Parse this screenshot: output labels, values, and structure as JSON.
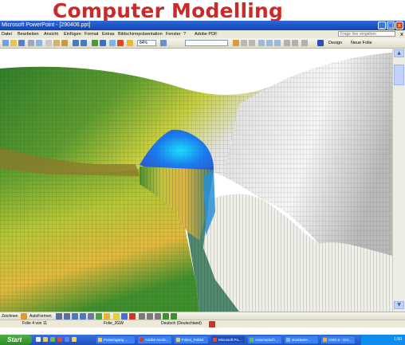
{
  "banner": {
    "title": "Computer Modelling"
  },
  "window": {
    "title": "Microsoft PowerPoint - [290406.ppt]",
    "controls": [
      "_",
      "□",
      "x"
    ]
  },
  "menubar": {
    "items": [
      "Datei",
      "Bearbeiten",
      "Ansicht",
      "Einfügen",
      "Format",
      "Extras",
      "Bildschirmpräsentation",
      "Fenster",
      "?",
      "Adobe PDF"
    ],
    "help_placeholder": "Frage hier eingeben",
    "doc_close": "x"
  },
  "toolbar": {
    "zoom": "84%",
    "design_label": "Design",
    "new_slide_label": "Neue Folie"
  },
  "drawing_toolbar": {
    "zeichnen": "Zeichnen",
    "autoformen": "AutoFormen"
  },
  "statusbar": {
    "slide": "Folie 4 von 11",
    "template": "Folie_3GW",
    "language": "Deutsch (Deutschland)"
  },
  "taskbar": {
    "start": "Start",
    "buttons": [
      "Posteingang ...",
      "Adobe Acrob...",
      "Folien_Feb04",
      "Microsoft Po...",
      "Automatisch ...",
      "strukturen...",
      "GMS 6 - Gro..."
    ],
    "clock": "1:50"
  },
  "colors": {
    "banner_title": "#cc2a2a",
    "titlebar": "#0f45b5",
    "taskbar": "#245edb",
    "start": "#3c9a32"
  },
  "icons": [
    "disk-icon",
    "folder-icon",
    "print-icon",
    "search-icon",
    "scissors-icon",
    "undo-icon",
    "redo-icon",
    "chart-icon",
    "table-icon",
    "arrow-icon",
    "rectangle-icon",
    "ellipse-icon",
    "textbox-icon"
  ]
}
